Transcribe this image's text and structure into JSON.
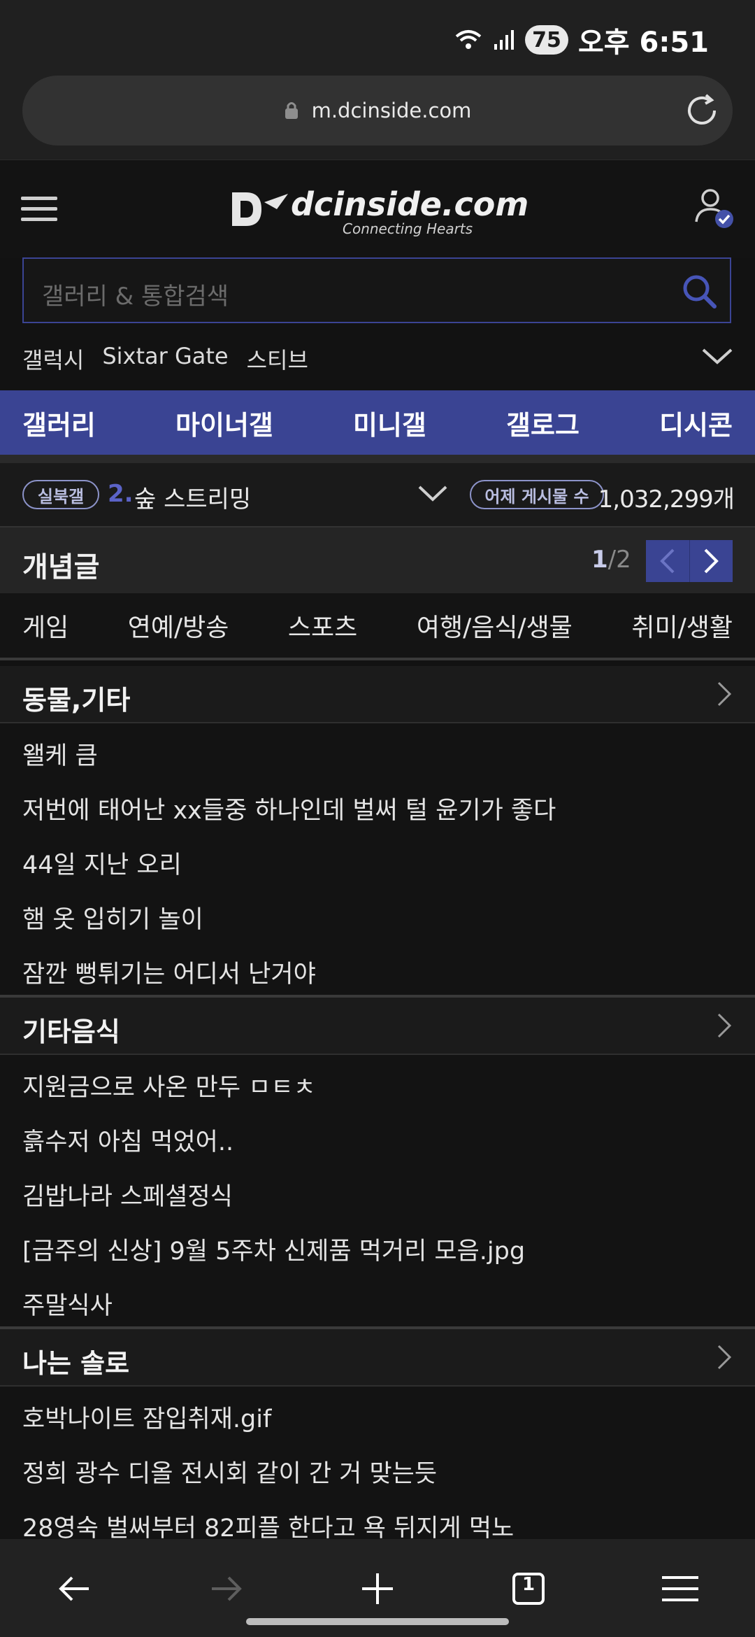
{
  "status_bar": {
    "battery": "75",
    "time": "오후 6:51"
  },
  "browser": {
    "url": "m.dcinside.com"
  },
  "header": {
    "logo_name": "dcinside.com",
    "logo_tagline": "Connecting Hearts"
  },
  "search": {
    "placeholder": "갤러리 & 통합검색"
  },
  "shortcuts": [
    "갤럭시",
    "Sixtar Gate",
    "스티브"
  ],
  "nav_tabs": [
    "갤러리",
    "마이너갤",
    "미니갤",
    "갤로그",
    "디시콘"
  ],
  "realtime": {
    "badge": "실북갤",
    "rank": "2.",
    "title": "숲 스트리밍",
    "count_label": "어제 게시물 수",
    "count_value": "1,032,299개"
  },
  "concept": {
    "title": "개념글",
    "page_current": "1",
    "page_total": "/2"
  },
  "categories": [
    "게임",
    "연예/방송",
    "스포츠",
    "여행/음식/생물",
    "취미/생활"
  ],
  "sections": [
    {
      "title": "동물,기타",
      "posts": [
        "왤케 큼",
        "저번에 태어난 xx들중 하나인데 벌써 털 윤기가 좋다",
        "44일 지난 오리",
        "햄 옷 입히기 놀이",
        "잠깐 뻥튀기는 어디서 난거야"
      ]
    },
    {
      "title": "기타음식",
      "posts": [
        "지원금으로 사온 만두 ㅁㅌㅊ",
        "흙수저 아침 먹었어..",
        "김밥나라 스페셜정식",
        "[금주의 신상] 9월 5주차 신제품 먹거리 모음.jpg",
        "주말식사"
      ]
    },
    {
      "title": "나는 솔로",
      "posts": [
        "호박나이트 잠입취재.gif",
        "정희 광수 디올 전시회 같이 간 거 맞는듯",
        "28영숙 벌써부터 82피플 한다고 욕 뒤지게 먹노"
      ]
    }
  ],
  "bottom_bar": {
    "tab_count": "1"
  },
  "colors": {
    "accent": "#3a4493",
    "background": "#121212"
  }
}
